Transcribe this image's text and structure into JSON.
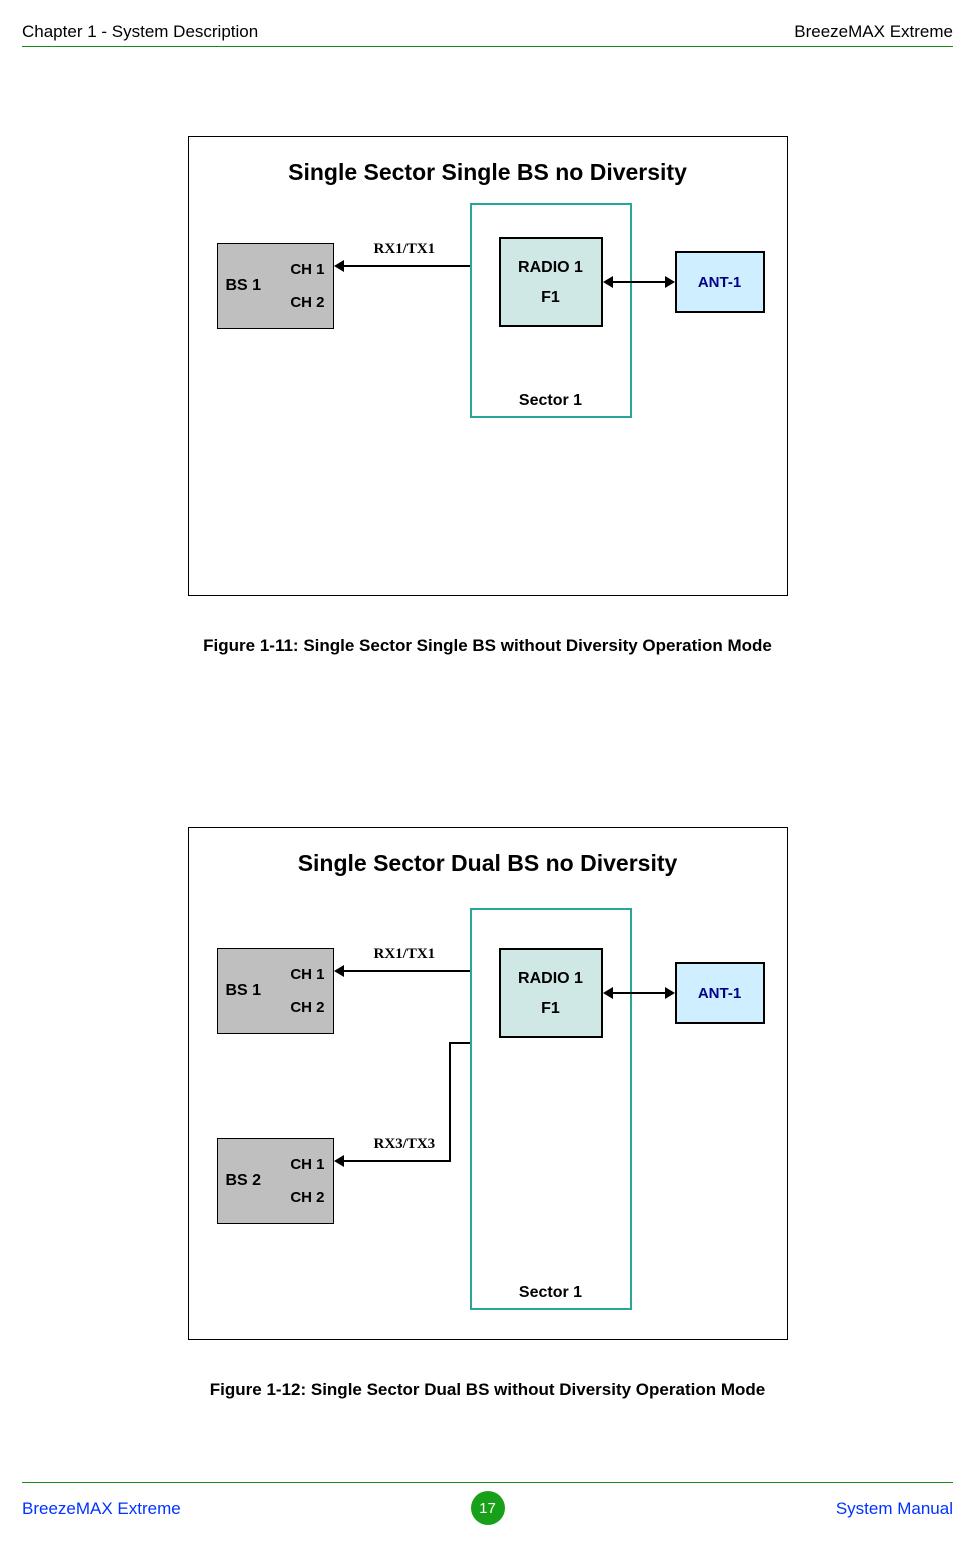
{
  "header": {
    "left": "Chapter 1 - System Description",
    "right": "BreezeMAX Extreme"
  },
  "footer": {
    "left": "BreezeMAX Extreme",
    "page": "17",
    "right": "System Manual"
  },
  "fig1": {
    "title": "Single Sector Single BS no Diversity",
    "caption": "Figure 1-11: Single Sector Single BS without Diversity Operation Mode",
    "bs1": {
      "label": "BS 1",
      "ch1": "CH 1",
      "ch2": "CH 2"
    },
    "link1": "RX1/TX1",
    "sector": "Sector 1",
    "radio": {
      "line1": "RADIO 1",
      "line2": "F1"
    },
    "ant": "ANT-1"
  },
  "fig2": {
    "title": "Single Sector Dual BS no Diversity",
    "caption": "Figure 1-12: Single Sector Dual BS without Diversity Operation Mode",
    "bs1": {
      "label": "BS 1",
      "ch1": "CH 1",
      "ch2": "CH 2"
    },
    "bs2": {
      "label": "BS 2",
      "ch1": "CH 1",
      "ch2": "CH 2"
    },
    "link1": "RX1/TX1",
    "link2": "RX3/TX3",
    "sector": "Sector 1",
    "radio": {
      "line1": "RADIO 1",
      "line2": "F1"
    },
    "ant": "ANT-1"
  }
}
